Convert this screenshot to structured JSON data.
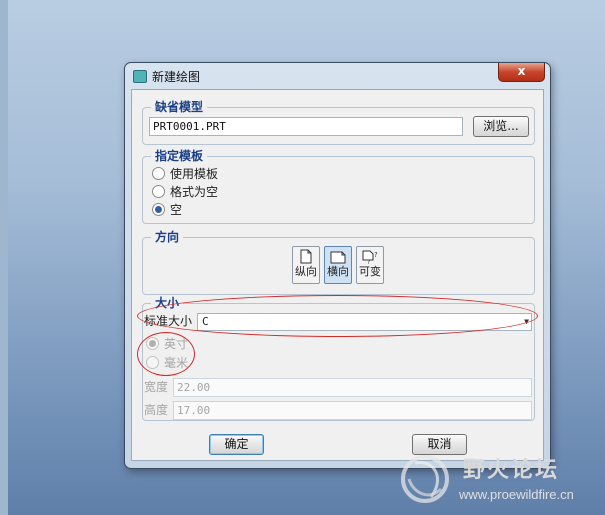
{
  "dialog": {
    "title": "新建绘图",
    "close_symbol": "x"
  },
  "default_model": {
    "legend": "缺省模型",
    "value": "PRT0001.PRT",
    "browse_label": "浏览..."
  },
  "template": {
    "legend": "指定模板",
    "options": [
      {
        "label": "使用模板",
        "checked": false
      },
      {
        "label": "格式为空",
        "checked": false
      },
      {
        "label": "空",
        "checked": true
      }
    ]
  },
  "orientation": {
    "legend": "方向",
    "buttons": [
      {
        "label": "纵向",
        "icon": "portrait-page-icon",
        "active": false
      },
      {
        "label": "横向",
        "icon": "landscape-page-icon",
        "active": true
      },
      {
        "label": "可变",
        "icon": "variable-page-icon",
        "active": false
      }
    ]
  },
  "size": {
    "legend": "大小",
    "standard_label": "标准大小",
    "standard_value": "C",
    "units": [
      {
        "label": "英寸",
        "checked": true
      },
      {
        "label": "毫米",
        "checked": false
      }
    ],
    "width_label": "宽度",
    "width_value": "22.00",
    "height_label": "高度",
    "height_value": "17.00"
  },
  "footer": {
    "ok_label": "确定",
    "cancel_label": "取消"
  },
  "watermark": {
    "text_cn": "野火论坛",
    "url": "www.proewildfire.cn"
  },
  "colors": {
    "legend_text": "#1b3f86",
    "annotation_red": "#d42a2a",
    "close_button": "#c8452b"
  }
}
